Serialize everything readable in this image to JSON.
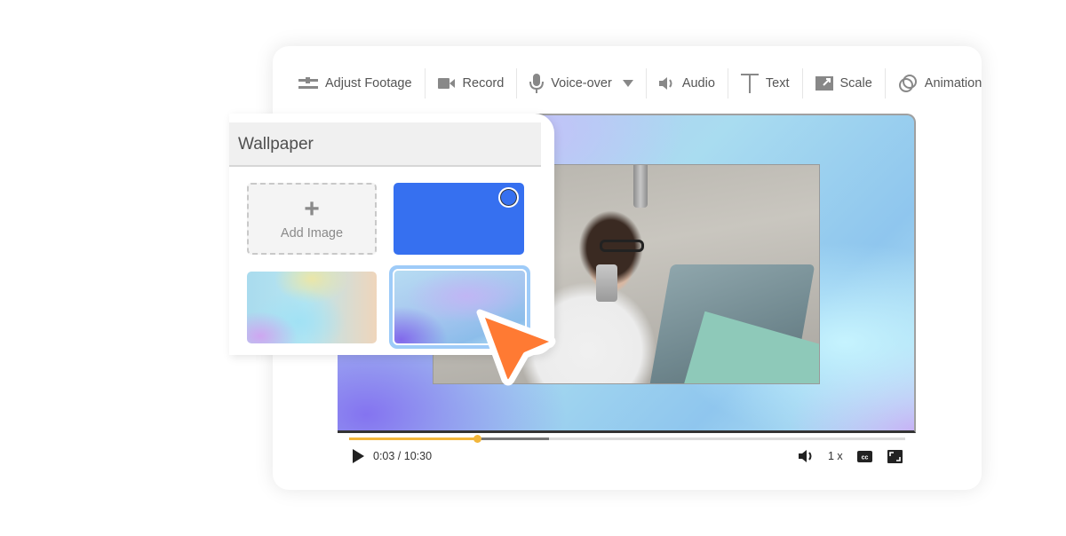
{
  "toolbar": {
    "items": [
      {
        "label": "Adjust Footage",
        "icon": "sliders-icon"
      },
      {
        "label": "Record",
        "icon": "video-camera-icon"
      },
      {
        "label": "Voice-over",
        "icon": "microphone-icon",
        "dropdown": true
      },
      {
        "label": "Audio",
        "icon": "speaker-icon"
      },
      {
        "label": "Text",
        "icon": "text-t-icon"
      },
      {
        "label": "Scale",
        "icon": "scale-arrow-icon"
      },
      {
        "label": "Animation",
        "icon": "overlapping-rings-icon"
      }
    ]
  },
  "wallpaper_panel": {
    "title": "Wallpaper",
    "add_image": {
      "icon": "plus-icon",
      "label": "Add Image",
      "plus": "+"
    },
    "tiles": [
      {
        "name": "solid-blue",
        "color": "#3670F0"
      },
      {
        "name": "pastel-gradient"
      },
      {
        "name": "purple-blue-gradient",
        "selected": true
      }
    ]
  },
  "player": {
    "time": "0:03 / 10:30",
    "played_fraction": 0.23,
    "buffered_fraction": 0.36,
    "speed": "1 x",
    "accent_color": "#F2B63B"
  },
  "cursor": {
    "color": "#FF7A33"
  }
}
